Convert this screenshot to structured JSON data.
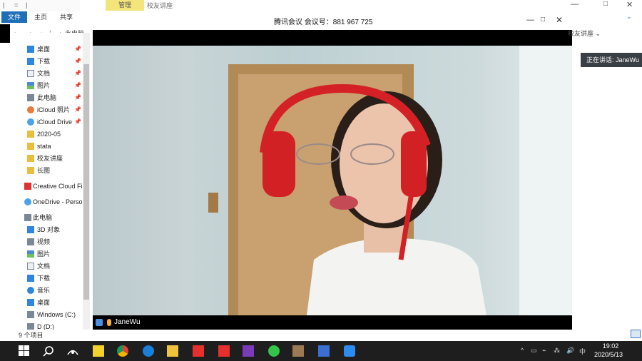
{
  "explorer": {
    "quick_access_toolbar": [
      "|",
      "=",
      "|"
    ],
    "tabs": [
      "文件",
      "主页",
      "共享"
    ],
    "manage_tab": "管理",
    "title": "校友讲座",
    "window_controls": {
      "minimize": "—",
      "maximize": "□",
      "close": "✕"
    },
    "ribbon_expand": "⌄",
    "nav_toolbar": [
      "←",
      "→",
      "⌄",
      "↑"
    ],
    "address_breadcrumb": "▸ 此电脑",
    "nav_items": [
      {
        "label": "桌面",
        "icon": "desktop-icon",
        "pinned": true
      },
      {
        "label": "下载",
        "icon": "download-icon",
        "pinned": true
      },
      {
        "label": "文档",
        "icon": "document-icon",
        "pinned": true
      },
      {
        "label": "图片",
        "icon": "picture-icon",
        "pinned": true
      },
      {
        "label": "此电脑",
        "icon": "computer-icon",
        "pinned": true
      },
      {
        "label": "iCloud 照片",
        "icon": "icloud-photos-icon",
        "pinned": true
      },
      {
        "label": "iCloud Drive",
        "icon": "icloud-drive-icon",
        "pinned": true
      },
      {
        "label": "2020-05",
        "icon": "folder-icon",
        "pinned": false
      },
      {
        "label": "stata",
        "icon": "folder-icon",
        "pinned": false
      },
      {
        "label": "校友讲座",
        "icon": "folder-icon",
        "pinned": false
      },
      {
        "label": "长图",
        "icon": "folder-icon",
        "pinned": false
      },
      {
        "label": "Creative Cloud Fi",
        "icon": "creative-cloud-icon",
        "pinned": false
      },
      {
        "label": "OneDrive - Perso",
        "icon": "onedrive-icon",
        "pinned": false
      },
      {
        "label": "此电脑",
        "icon": "computer-icon",
        "pinned": false
      },
      {
        "label": "3D 对象",
        "icon": "3d-objects-icon",
        "pinned": false
      },
      {
        "label": "视频",
        "icon": "video-icon",
        "pinned": false
      },
      {
        "label": "图片",
        "icon": "picture-icon",
        "pinned": false
      },
      {
        "label": "文档",
        "icon": "document-icon",
        "pinned": false
      },
      {
        "label": "下载",
        "icon": "download-icon",
        "pinned": false
      },
      {
        "label": "音乐",
        "icon": "music-icon",
        "pinned": false
      },
      {
        "label": "桌面",
        "icon": "desktop-icon",
        "pinned": false
      },
      {
        "label": "Windows (C:)",
        "icon": "drive-icon",
        "pinned": false
      },
      {
        "label": "D (D:)",
        "icon": "drive-icon",
        "pinned": false
      }
    ],
    "status_count": "9 个项目",
    "right_breadcrumb": "校友讲座 ⌄",
    "view_icon": "details-view-icon"
  },
  "meeting": {
    "title": "腾讯会议 会议号：881 967 725",
    "window_controls": {
      "minimize": "—",
      "maximize": "□",
      "close": "✕"
    },
    "speaking_label": "正在讲话: JaneWu",
    "participant_name": "JaneWu"
  },
  "taskbar": {
    "apps": [
      "start-icon",
      "search-icon",
      "task-view-icon",
      "sticky-notes-icon",
      "chrome-icon",
      "edge-icon",
      "file-explorer-icon",
      "app-red-icon",
      "app-red-2-icon",
      "onenote-icon",
      "wechat-icon",
      "photo-app-icon",
      "grid-app-icon",
      "tencent-meeting-icon"
    ],
    "tray": [
      "^",
      "▭",
      "⌁",
      "⁂",
      "🔊",
      "中"
    ],
    "time": "19:02",
    "date": "2020/5/13"
  },
  "colors": {
    "accent": "#1e6fb8",
    "taskbar": "#1e1e1e",
    "manage_tab": "#f3e57a",
    "speaking_chip": "#3a3f45"
  }
}
